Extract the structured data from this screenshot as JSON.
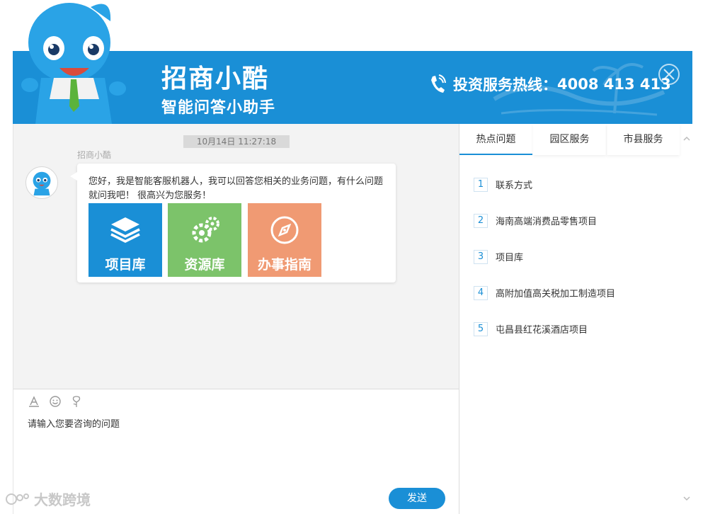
{
  "header": {
    "title": "招商小酷",
    "subtitle": "智能问答小助手",
    "hotline_label": "投资服务热线：",
    "hotline_number": "4008 413 413"
  },
  "chat": {
    "timestamp": "10月14日 11:27:18",
    "bot_name": "招商小酷",
    "greeting": "您好，我是智能客服机器人，我可以回答您相关的业务问题，有什么问题就问我吧！ 很高兴为您服务！",
    "tiles": [
      {
        "label": "项目库",
        "color": "#1a8fd6",
        "icon": "layers-icon"
      },
      {
        "label": "资源库",
        "color": "#7cc36a",
        "icon": "gears-icon"
      },
      {
        "label": "办事指南",
        "color": "#f09a73",
        "icon": "compass-icon"
      }
    ]
  },
  "input": {
    "placeholder": "请输入您要咨询的问题",
    "send_label": "发送",
    "tools": [
      "font-icon",
      "emoji-icon",
      "rose-icon"
    ]
  },
  "side": {
    "tabs": [
      "热点问题",
      "园区服务",
      "市县服务"
    ],
    "active_tab": 0,
    "questions": [
      {
        "num": "1",
        "text": "联系方式"
      },
      {
        "num": "2",
        "text": "海南高端消费品零售项目"
      },
      {
        "num": "3",
        "text": "项目库"
      },
      {
        "num": "4",
        "text": "高附加值高关税加工制造项目"
      },
      {
        "num": "5",
        "text": "屯昌县红花溪酒店项目"
      }
    ]
  },
  "watermark": "大数跨境",
  "colors": {
    "brand": "#1a8fd6",
    "chat_bg": "#f3f3f3"
  }
}
